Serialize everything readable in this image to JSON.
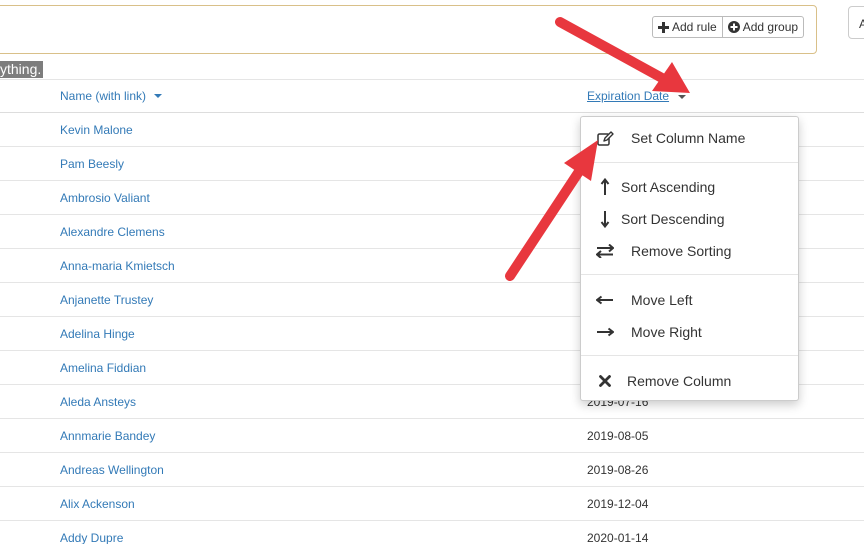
{
  "toolbar": {
    "add_rule_label": "Add rule",
    "add_group_label": "Add group",
    "right_button_label": "A"
  },
  "highlight_text": "ything.",
  "table": {
    "headers": {
      "name": "Name (with link)",
      "expiration": "Expiration Date"
    },
    "rows": [
      {
        "name": "Kevin Malone",
        "date": ""
      },
      {
        "name": "Pam Beesly",
        "date": ""
      },
      {
        "name": "Ambrosio Valiant",
        "date": ""
      },
      {
        "name": "Alexandre Clemens",
        "date": ""
      },
      {
        "name": "Anna-maria Kmietsch",
        "date": ""
      },
      {
        "name": "Anjanette Trustey",
        "date": ""
      },
      {
        "name": "Adelina Hinge",
        "date": ""
      },
      {
        "name": "Amelina Fiddian",
        "date": ""
      },
      {
        "name": "Aleda Ansteys",
        "date": "2019-07-16"
      },
      {
        "name": "Annmarie Bandey",
        "date": "2019-08-05"
      },
      {
        "name": "Andreas Wellington",
        "date": "2019-08-26"
      },
      {
        "name": "Alix Ackenson",
        "date": "2019-12-04"
      },
      {
        "name": "Addy Dupre",
        "date": "2020-01-14"
      }
    ]
  },
  "column_menu": {
    "set_column_name": "Set Column Name",
    "sort_ascending": "Sort Ascending",
    "sort_descending": "Sort Descending",
    "remove_sorting": "Remove Sorting",
    "move_left": "Move Left",
    "move_right": "Move Right",
    "remove_column": "Remove Column"
  },
  "colors": {
    "link": "#337ab7",
    "arrow": "#e8373e",
    "filter_border": "#d9c089"
  }
}
